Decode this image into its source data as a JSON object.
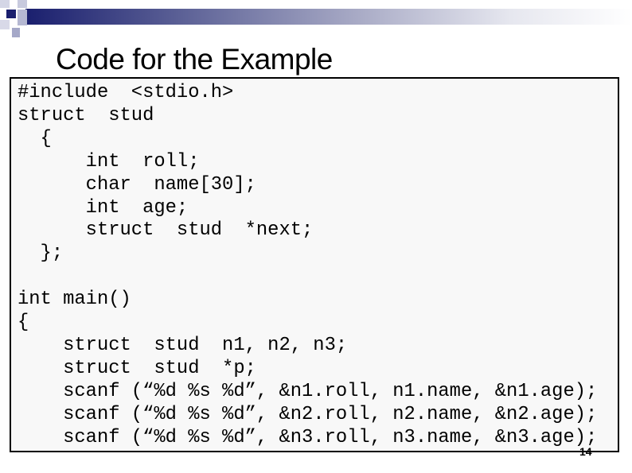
{
  "slide": {
    "title": "Code for the Example",
    "page_number": "14",
    "accent_color": "#1a1f6e",
    "code_lines": [
      "#include  <stdio.h>",
      "struct  stud",
      "  {",
      "      int  roll;",
      "      char  name[30];",
      "      int  age;",
      "      struct  stud  *next;",
      "  };",
      "",
      "int main()",
      "{",
      "    struct  stud  n1, n2, n3;",
      "    struct  stud  *p;",
      "    scanf (“%d %s %d”, &n1.roll, n1.name, &n1.age);",
      "    scanf (“%d %s %d”, &n2.roll, n2.name, &n2.age);",
      "    scanf (“%d %s %d”, &n3.roll, n3.name, &n3.age);"
    ]
  }
}
